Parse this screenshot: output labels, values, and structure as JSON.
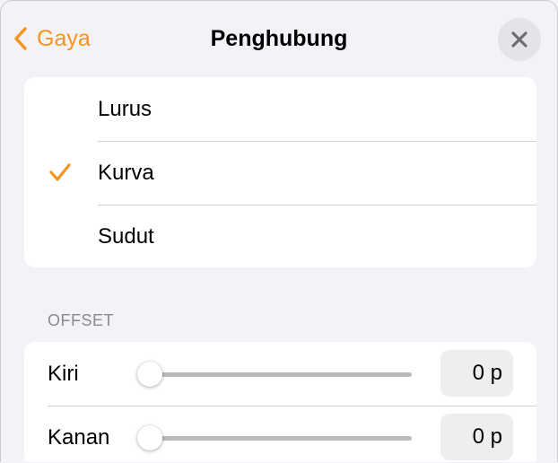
{
  "header": {
    "back_label": "Gaya",
    "title": "Penghubung",
    "accent_color": "#f7941d"
  },
  "connector_styles": {
    "items": [
      {
        "label": "Lurus",
        "selected": false
      },
      {
        "label": "Kurva",
        "selected": true
      },
      {
        "label": "Sudut",
        "selected": false
      }
    ]
  },
  "offset": {
    "section_label": "OFFSET",
    "rows": [
      {
        "label": "Kiri",
        "value": "0 p",
        "level": 0
      },
      {
        "label": "Kanan",
        "value": "0 p",
        "level": 0
      }
    ]
  },
  "icons": {
    "back": "chevron-left-icon",
    "close": "close-icon",
    "check": "checkmark-icon"
  }
}
